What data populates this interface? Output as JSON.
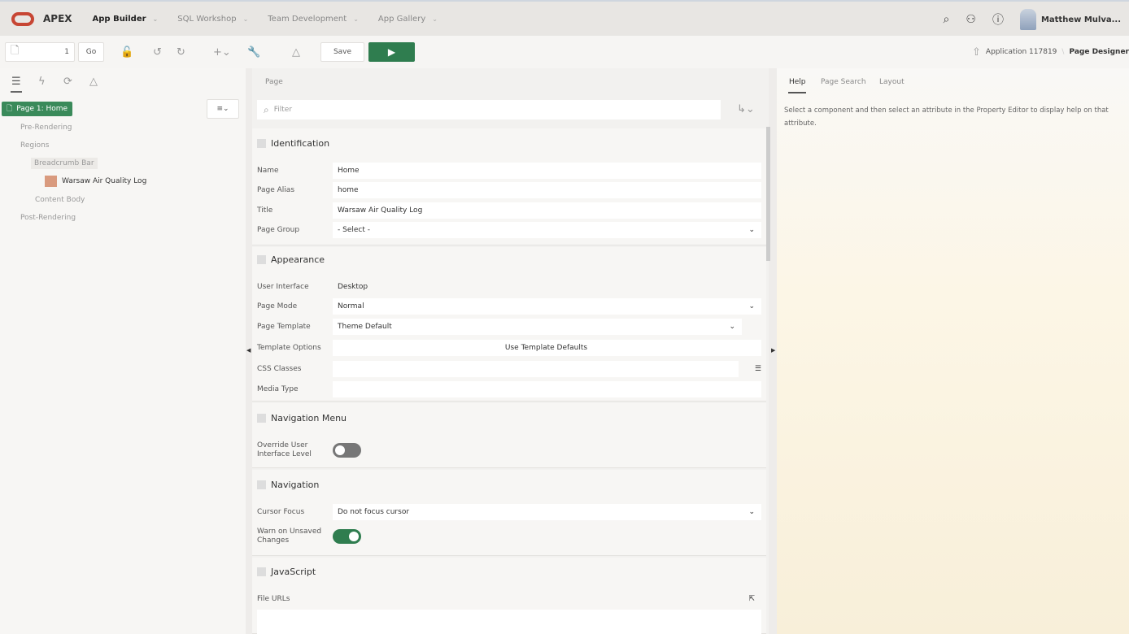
{
  "topnav": {
    "brand": "APEX",
    "items": [
      "App Builder",
      "SQL Workshop",
      "Team Development",
      "App Gallery"
    ],
    "user": "Matthew Mulva..."
  },
  "toolbar": {
    "page_number": "1",
    "go": "Go",
    "save": "Save",
    "breadcrumb_app": "Application 117819",
    "breadcrumb_page": "Page Designer"
  },
  "tree": {
    "root": "Page 1: Home",
    "items": [
      "Pre-Rendering",
      "Regions",
      "Breadcrumb Bar",
      "Warsaw Air Quality Log",
      "Content Body",
      "Post-Rendering"
    ]
  },
  "center": {
    "title": "Page",
    "filter_placeholder": "Filter",
    "identification": {
      "title": "Identification",
      "name_label": "Name",
      "name": "Home",
      "alias_label": "Page Alias",
      "alias": "home",
      "title_label": "Title",
      "title_value": "Warsaw Air Quality Log",
      "group_label": "Page Group",
      "group": "- Select -"
    },
    "appearance": {
      "title": "Appearance",
      "ui_label": "User Interface",
      "ui": "Desktop",
      "mode_label": "Page Mode",
      "mode": "Normal",
      "template_label": "Page Template",
      "template": "Theme Default",
      "options_label": "Template Options",
      "options": "Use Template Defaults",
      "css_label": "CSS Classes",
      "media_label": "Media Type"
    },
    "navmenu": {
      "title": "Navigation Menu",
      "override_label": "Override User Interface Level"
    },
    "navigation": {
      "title": "Navigation",
      "cursor_label": "Cursor Focus",
      "cursor": "Do not focus cursor",
      "warn_label": "Warn on Unsaved Changes"
    },
    "javascript": {
      "title": "JavaScript",
      "file_urls_label": "File URLs"
    }
  },
  "right": {
    "tabs": [
      "Help",
      "Page Search",
      "Layout"
    ],
    "help_text": "Select a component and then select an attribute in the Property Editor to display help on that attribute."
  }
}
